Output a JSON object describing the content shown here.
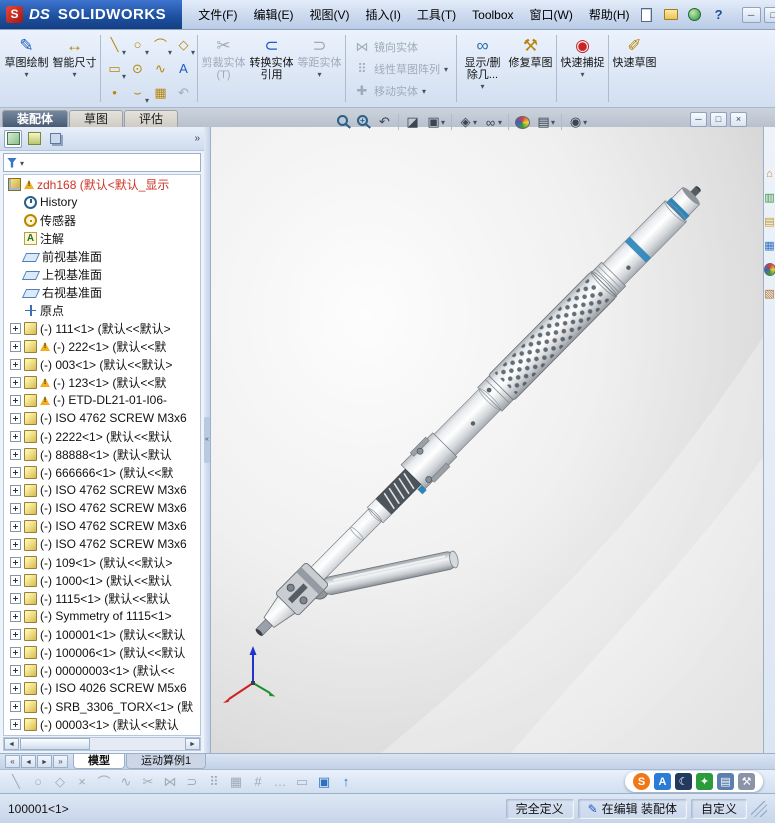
{
  "colors": {
    "accent": "#2e86b8",
    "triad_x": "#cc2222",
    "triad_y": "#1e8f2e",
    "triad_z": "#2233cc"
  },
  "titlebar": {
    "brand_prefix": "DS",
    "brand": "SOLIDWORKS",
    "app_icon_glyph": "S",
    "actions": [
      {
        "icon": "new-document"
      },
      {
        "icon": "open-folder"
      },
      {
        "icon": "globe"
      },
      {
        "icon": "help",
        "glyph": "?"
      }
    ],
    "window_buttons": [
      {
        "icon": "minimize",
        "glyph": "─"
      },
      {
        "icon": "maximize",
        "glyph": "□"
      },
      {
        "icon": "close",
        "glyph": "×"
      }
    ]
  },
  "menu": {
    "items": [
      "文件(F)",
      "编辑(E)",
      "视图(V)",
      "插入(I)",
      "工具(T)",
      "Toolbox",
      "窗口(W)",
      "帮助(H)"
    ]
  },
  "toolbar": {
    "big1": [
      {
        "label": "草图绘制",
        "icon": "sketch",
        "glyph": "✎",
        "dropdown": true,
        "enabled": true
      },
      {
        "label": "智能尺寸",
        "icon": "smart-dimension",
        "glyph": "↔",
        "dropdown": true,
        "enabled": true
      }
    ],
    "entities": [
      {
        "icon": "line",
        "glyph": "╲",
        "dropdown": true,
        "enabled": true
      },
      {
        "icon": "circle",
        "glyph": "○",
        "dropdown": true,
        "enabled": true
      },
      {
        "icon": "arc",
        "glyph": "⌒",
        "dropdown": true,
        "enabled": true
      },
      {
        "icon": "polygon",
        "glyph": "◇",
        "dropdown": true,
        "enabled": true
      },
      {
        "icon": "rectangle",
        "glyph": "▭",
        "dropdown": true,
        "enabled": true
      },
      {
        "icon": "ellipse",
        "glyph": "⊙",
        "enabled": true
      },
      {
        "icon": "spline",
        "glyph": "∿",
        "enabled": true
      },
      {
        "icon": "text",
        "glyph": "A",
        "enabled": true
      },
      {
        "icon": "point",
        "glyph": "•",
        "enabled": true
      },
      {
        "icon": "fillet",
        "glyph": "⌣",
        "dropdown": true,
        "enabled": true
      },
      {
        "icon": "pattern",
        "glyph": "▦",
        "enabled": true
      },
      {
        "icon": "undo",
        "glyph": "↶",
        "enabled": false
      }
    ],
    "big2": [
      {
        "label": "剪裁实体(T)",
        "icon": "trim",
        "glyph": "✂",
        "enabled": false
      },
      {
        "label": "转换实体引用",
        "icon": "convert-entities",
        "glyph": "⊂",
        "enabled": true
      },
      {
        "label": "等距实体",
        "icon": "offset-entities",
        "glyph": "⊃",
        "dropdown": true,
        "enabled": false
      }
    ],
    "stack": [
      {
        "label": "镜向实体",
        "icon": "mirror-entities",
        "glyph": "⋈",
        "enabled": false
      },
      {
        "label": "线性草图阵列",
        "icon": "linear-sketch-pattern",
        "glyph": "⠿",
        "dropdown": true,
        "enabled": false
      },
      {
        "label": "移动实体",
        "icon": "move-entities",
        "glyph": "✚",
        "dropdown": true,
        "enabled": false
      }
    ],
    "big3": [
      {
        "label": "显示/删除几...",
        "icon": "display-delete-relations",
        "glyph": "∞",
        "dropdown": true,
        "enabled": true
      },
      {
        "label": "修复草图",
        "icon": "repair-sketch",
        "glyph": "⚒",
        "enabled": true
      }
    ],
    "big4": [
      {
        "label": "快速捕捉",
        "icon": "quick-snaps",
        "glyph": "◉",
        "dropdown": true,
        "enabled": true
      }
    ],
    "big5": [
      {
        "label": "快速草图",
        "icon": "rapid-sketch",
        "glyph": "✐",
        "enabled": true
      }
    ]
  },
  "command_tabs": [
    {
      "label": "装配体",
      "active": true
    },
    {
      "label": "草图"
    },
    {
      "label": "评估"
    }
  ],
  "panel": {
    "manager_tabs": [
      {
        "icon": "featuremanager",
        "active": true
      },
      {
        "icon": "propertymanager"
      },
      {
        "icon": "configurationmanager"
      },
      {
        "icon": "displaymanager"
      }
    ],
    "overflow_glyph": "»"
  },
  "tree": {
    "items": [
      {
        "icon": "assembly",
        "label": "zdh168 (默认<默认_显示",
        "warn": true,
        "color": "red",
        "indent": 0
      },
      {
        "icon": "history",
        "label": "History",
        "indent": 2
      },
      {
        "icon": "sensors",
        "label": "传感器",
        "indent": 2
      },
      {
        "icon": "annotations",
        "label": "注解",
        "indent": 2
      },
      {
        "icon": "plane",
        "label": "前视基准面",
        "indent": 2
      },
      {
        "icon": "plane",
        "label": "上视基准面",
        "indent": 2
      },
      {
        "icon": "plane",
        "label": "右视基准面",
        "indent": 2
      },
      {
        "icon": "origin",
        "label": "原点",
        "indent": 2
      },
      {
        "icon": "part",
        "label": "(-) 111<1> (默认<<默认>",
        "expand": true,
        "indent": 1
      },
      {
        "icon": "part",
        "label": "(-) 222<1> (默认<<默",
        "expand": true,
        "warn": true,
        "indent": 1
      },
      {
        "icon": "part",
        "label": "(-) 003<1> (默认<<默认>",
        "expand": true,
        "indent": 1
      },
      {
        "icon": "part",
        "label": "(-) 123<1> (默认<<默",
        "expand": true,
        "warn": true,
        "indent": 1
      },
      {
        "icon": "part",
        "label": "(-) ETD-DL21-01-I06-",
        "expand": true,
        "warn": true,
        "indent": 1
      },
      {
        "icon": "part",
        "label": "(-) ISO 4762 SCREW M3x6",
        "expand": true,
        "indent": 1
      },
      {
        "icon": "part",
        "label": "(-) 2222<1> (默认<<默认",
        "expand": true,
        "indent": 1
      },
      {
        "icon": "part",
        "label": "(-) 88888<1> (默认<默认",
        "expand": true,
        "indent": 1
      },
      {
        "icon": "part",
        "label": "(-) 666666<1> (默认<<默",
        "expand": true,
        "indent": 1
      },
      {
        "icon": "part",
        "label": "(-) ISO 4762 SCREW M3x6",
        "expand": true,
        "indent": 1
      },
      {
        "icon": "part",
        "label": "(-) ISO 4762 SCREW M3x6",
        "expand": true,
        "indent": 1
      },
      {
        "icon": "part",
        "label": "(-) ISO 4762 SCREW M3x6",
        "expand": true,
        "indent": 1
      },
      {
        "icon": "part",
        "label": "(-) ISO 4762 SCREW M3x6",
        "expand": true,
        "indent": 1
      },
      {
        "icon": "part",
        "label": "(-) 109<1> (默认<<默认>",
        "expand": true,
        "indent": 1
      },
      {
        "icon": "part",
        "label": "(-) 1000<1> (默认<<默认",
        "expand": true,
        "indent": 1
      },
      {
        "icon": "part",
        "label": "(-) 1115<1> (默认<<默认",
        "expand": true,
        "indent": 1
      },
      {
        "icon": "part",
        "label": "(-) Symmetry of 1115<1>",
        "expand": true,
        "indent": 1
      },
      {
        "icon": "part",
        "label": "(-) 100001<1> (默认<<默认",
        "expand": true,
        "indent": 1
      },
      {
        "icon": "part",
        "label": "(-) 100006<1> (默认<<默认",
        "expand": true,
        "indent": 1
      },
      {
        "icon": "part",
        "label": "(-) 00000003<1> (默认<<",
        "expand": true,
        "indent": 1
      },
      {
        "icon": "part",
        "label": "(-) ISO 4026 SCREW M5x6",
        "expand": true,
        "indent": 1
      },
      {
        "icon": "part",
        "label": "(-) SRB_3306_TORX<1> (默",
        "expand": true,
        "indent": 1
      },
      {
        "icon": "part",
        "label": "(-) 00003<1> (默认<<默认",
        "expand": true,
        "indent": 1
      }
    ]
  },
  "hud": {
    "items": [
      {
        "icon": "zoom-fit"
      },
      {
        "icon": "zoom-area",
        "glyph": "+"
      },
      {
        "icon": "previous-view",
        "glyph": "↶"
      },
      {
        "sep": true
      },
      {
        "icon": "section-view",
        "glyph": "◪"
      },
      {
        "icon": "view-orientation",
        "glyph": "▣",
        "dropdown": true
      },
      {
        "sep": true
      },
      {
        "icon": "display-style",
        "glyph": "◈",
        "dropdown": true
      },
      {
        "icon": "hide-show-items",
        "glyph": "∞",
        "dropdown": true
      },
      {
        "sep": true
      },
      {
        "icon": "edit-appearance"
      },
      {
        "icon": "apply-scene",
        "glyph": "▤",
        "dropdown": true
      },
      {
        "sep": true
      },
      {
        "icon": "view-settings",
        "glyph": "◉",
        "dropdown": true
      }
    ]
  },
  "doc_window_buttons": [
    {
      "icon": "minimize",
      "glyph": "─"
    },
    {
      "icon": "restore",
      "glyph": "□"
    },
    {
      "icon": "close",
      "glyph": "×"
    }
  ],
  "taskpane": {
    "items": [
      {
        "icon": "home",
        "glyph": "⌂",
        "color": "#d9822b"
      },
      {
        "icon": "design-library",
        "glyph": "▥",
        "color": "#3a8f3a"
      },
      {
        "icon": "file-explorer",
        "glyph": "▤",
        "color": "#c9971f"
      },
      {
        "icon": "toolbox",
        "glyph": "▦",
        "color": "#2f6fbf"
      },
      {
        "icon": "appearances"
      },
      {
        "icon": "custom-properties",
        "glyph": "▧",
        "color": "#b0722a"
      }
    ]
  },
  "model_bar": {
    "nav": [
      "scroll-first",
      "scroll-prev",
      "scroll-next",
      "scroll-last"
    ],
    "tabs": [
      {
        "label": "模型",
        "active": true
      },
      {
        "label": "运动算例1"
      }
    ]
  },
  "bottom_toolbar": {
    "items": [
      {
        "icon": "sketch-line",
        "glyph": "╲",
        "enabled": false
      },
      {
        "icon": "circle",
        "glyph": "○",
        "enabled": false
      },
      {
        "icon": "polygon",
        "glyph": "◇",
        "enabled": false
      },
      {
        "icon": "erase",
        "glyph": "×",
        "enabled": false
      },
      {
        "icon": "arc",
        "glyph": "⌒",
        "enabled": false
      },
      {
        "icon": "spline",
        "glyph": "∿",
        "enabled": false
      },
      {
        "icon": "trim",
        "glyph": "✂",
        "enabled": false
      },
      {
        "icon": "mirror",
        "glyph": "⋈",
        "enabled": false
      },
      {
        "icon": "offset",
        "glyph": "⊃",
        "enabled": false
      },
      {
        "icon": "pattern",
        "glyph": "⠿",
        "enabled": false
      },
      {
        "icon": "grid",
        "glyph": "▦",
        "enabled": false
      },
      {
        "icon": "hatch",
        "glyph": "#",
        "enabled": false
      },
      {
        "icon": "more",
        "glyph": "…",
        "enabled": false
      },
      {
        "icon": "rectangle",
        "glyph": "▭",
        "enabled": false
      },
      {
        "icon": "isometric-view",
        "glyph": "▣",
        "color": "#2f6fbf",
        "enabled": true
      },
      {
        "icon": "exit-sketch",
        "glyph": "↑",
        "color": "#2f6fbf",
        "enabled": true
      }
    ]
  },
  "ime": {
    "items": [
      {
        "icon": "sogou",
        "glyph": "S",
        "bg": "#f07818",
        "shape": "round"
      },
      {
        "icon": "english-mode",
        "glyph": "A",
        "bg": "#2b7cd6"
      },
      {
        "icon": "night-mode",
        "glyph": "☾",
        "bg": "#223a5e"
      },
      {
        "icon": "addon",
        "glyph": "✦",
        "bg": "#2a9d3a"
      },
      {
        "icon": "soft-keyboard",
        "glyph": "▤",
        "bg": "#5b7fae"
      },
      {
        "icon": "ime-toolbox",
        "glyph": "⚒",
        "bg": "#8a94a6"
      }
    ]
  },
  "statusbar": {
    "selection": "100001<1>",
    "fully_defined": "完全定义",
    "editing": "在编辑 装配体",
    "custom": "自定义"
  }
}
